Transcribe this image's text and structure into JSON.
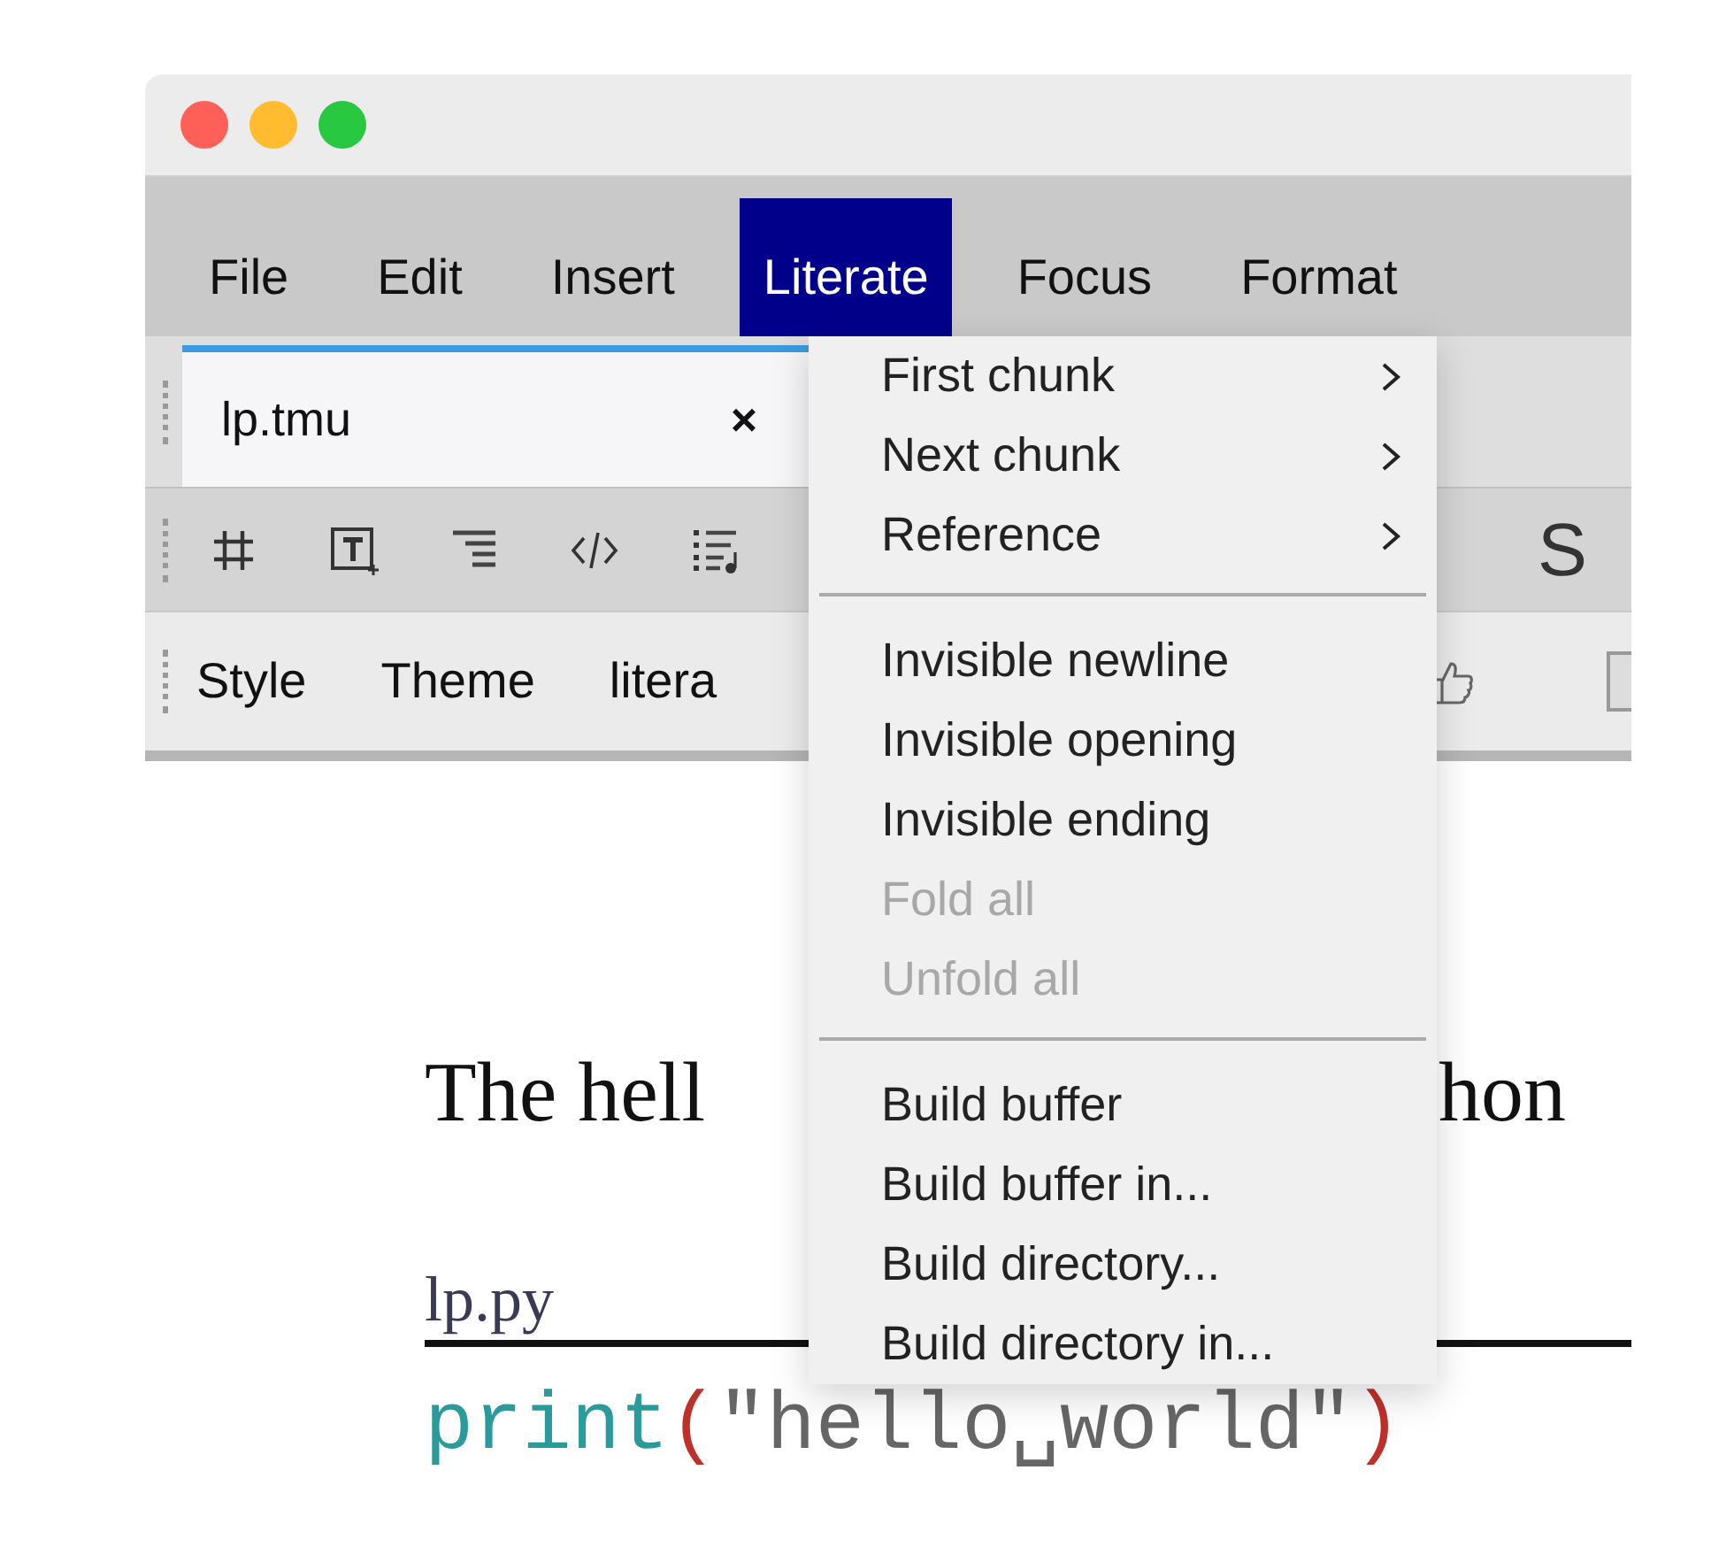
{
  "menu_bar": [
    {
      "label": "File",
      "selected": false
    },
    {
      "label": "Edit",
      "selected": false
    },
    {
      "label": "Insert",
      "selected": false
    },
    {
      "label": "Literate",
      "selected": true
    },
    {
      "label": "Focus",
      "selected": false
    },
    {
      "label": "Format",
      "selected": false
    }
  ],
  "tabs": [
    {
      "label": "lp.tmu",
      "selected": true,
      "close": "×"
    }
  ],
  "toolbar": {
    "icons": [
      {
        "kind": "grid"
      },
      {
        "kind": "text-frame"
      },
      {
        "kind": "align"
      },
      {
        "kind": "code"
      },
      {
        "kind": "list-music"
      }
    ],
    "glyphs": [
      "S"
    ]
  },
  "mode_bar": {
    "items": [
      "Style",
      "Theme",
      "litera"
    ]
  },
  "document": {
    "heading": [
      "The hell",
      "hon"
    ],
    "file_label": "lp.py",
    "code": [
      {
        "text": "print",
        "kind": "function"
      },
      {
        "text": "(",
        "kind": "paren"
      },
      {
        "text": "\"hello␣world\"",
        "kind": "string"
      },
      {
        "text": ")",
        "kind": "paren"
      }
    ]
  },
  "dropdown": [
    {
      "kind": "item",
      "label": "First chunk",
      "submenu": true,
      "disabled": false
    },
    {
      "kind": "item",
      "label": "Next chunk",
      "submenu": true,
      "disabled": false
    },
    {
      "kind": "item",
      "label": "Reference",
      "submenu": true,
      "disabled": false
    },
    {
      "kind": "separator"
    },
    {
      "kind": "item",
      "label": "Invisible newline",
      "submenu": false,
      "disabled": false
    },
    {
      "kind": "item",
      "label": "Invisible opening",
      "submenu": false,
      "disabled": false
    },
    {
      "kind": "item",
      "label": "Invisible ending",
      "submenu": false,
      "disabled": false
    },
    {
      "kind": "item",
      "label": "Fold all",
      "submenu": false,
      "disabled": true
    },
    {
      "kind": "item",
      "label": "Unfold all",
      "submenu": false,
      "disabled": true
    },
    {
      "kind": "separator"
    },
    {
      "kind": "item",
      "label": "Build buffer",
      "submenu": false,
      "disabled": false
    },
    {
      "kind": "item",
      "label": "Build buffer in...",
      "submenu": false,
      "disabled": false
    },
    {
      "kind": "item",
      "label": "Build directory...",
      "submenu": false,
      "disabled": false
    },
    {
      "kind": "item",
      "label": "Build directory in...",
      "submenu": false,
      "disabled": false
    }
  ]
}
